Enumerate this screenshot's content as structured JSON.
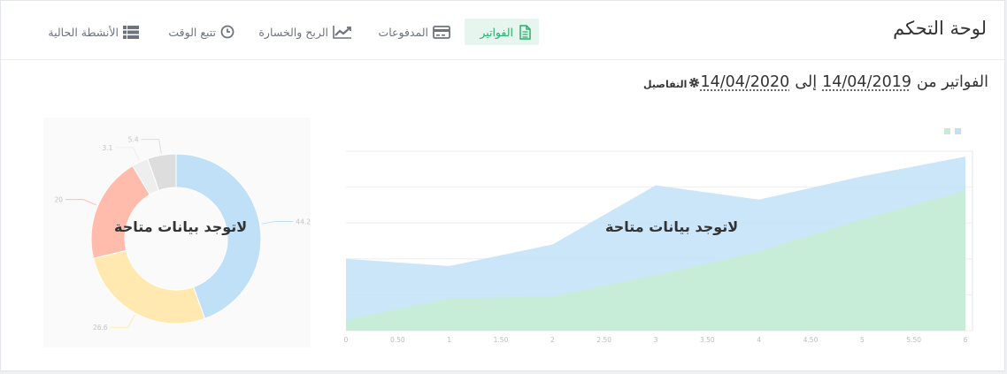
{
  "header": {
    "title": "لوحة التحكم",
    "tabs": [
      {
        "label": "الفواتير",
        "icon": "document-icon",
        "active": true
      },
      {
        "label": "المدفوعات",
        "icon": "credit-card-icon",
        "active": false
      },
      {
        "label": "الربح والخسارة",
        "icon": "trend-chart-icon",
        "active": false
      },
      {
        "label": "تتبع الوقت",
        "icon": "clock-icon",
        "active": false
      },
      {
        "label": "الأنشطة الحالية",
        "icon": "list-icon",
        "active": false
      }
    ]
  },
  "filter": {
    "prefix": "الفواتير من",
    "from_date": "14/04/2019",
    "connector": "إلى",
    "to_date": "14/04/2020",
    "details_label": "التفاصيل",
    "details_icon": "gear-icon"
  },
  "colors": {
    "accent": "#26b06d",
    "blue": "#bfe0f6",
    "green": "#c6ecd5",
    "pink": "#ffbcad",
    "yellow": "#ffe9b0",
    "light_gray": "#eeeeee",
    "gray": "#dddddd"
  },
  "no_data_text": "لاتوجد بيانات متاحة",
  "chart_data": [
    {
      "type": "pie",
      "variant": "donut",
      "labels": [],
      "values": [
        44.2,
        26.6,
        20,
        3.1,
        5.4
      ],
      "colors": [
        "#bfe0f6",
        "#ffe9b0",
        "#ffbcad",
        "#eeeeee",
        "#dddddd"
      ]
    },
    {
      "type": "area",
      "x": [
        0,
        1,
        2,
        3,
        4,
        5,
        6
      ],
      "x_ticks": [
        "0",
        "0.50",
        "1",
        "1.50",
        "2",
        "2.50",
        "3",
        "3.50",
        "4",
        "4.50",
        "5",
        "5.50",
        "6"
      ],
      "xlim": [
        0,
        6
      ],
      "ylim": [
        0,
        100
      ],
      "grid": true,
      "legend": "top-right",
      "series": [
        {
          "values": [
            40,
            36,
            48,
            81,
            73,
            86,
            97
          ],
          "color": "#bfe0f6"
        },
        {
          "values": [
            6,
            18,
            19,
            31,
            44,
            62,
            78
          ],
          "color": "#c6ecd5"
        }
      ]
    }
  ]
}
